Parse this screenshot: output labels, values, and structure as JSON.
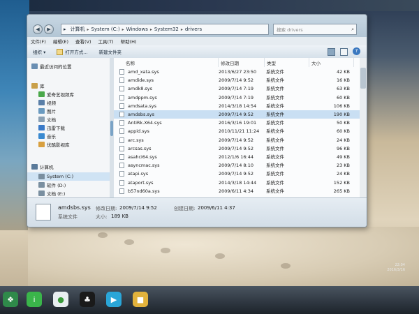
{
  "window": {
    "address": [
      "计算机",
      "System (C:)",
      "Windows",
      "System32",
      "drivers"
    ],
    "search_placeholder": "搜索 drivers"
  },
  "menubar": [
    "文件(F)",
    "编辑(E)",
    "查看(V)",
    "工具(T)",
    "帮助(H)"
  ],
  "toolbar": {
    "organize": "组织 ▾",
    "open_with": "打开方式...",
    "new_folder": "新建文件夹"
  },
  "nav": {
    "items": [
      {
        "label": "最近访问的位置",
        "icon": "recent-places-icon",
        "color": "#6a8fb3"
      },
      {
        "label": "库",
        "icon": "library-icon",
        "color": "#c9a04a"
      },
      {
        "label": "爱奇艺视频库",
        "icon": "video-library-icon",
        "color": "#4aa84a"
      },
      {
        "label": "视频",
        "icon": "video-icon",
        "color": "#5a7fa8"
      },
      {
        "label": "图片",
        "icon": "pictures-icon",
        "color": "#6a9ac0"
      },
      {
        "label": "文档",
        "icon": "documents-icon",
        "color": "#8aa0b4"
      },
      {
        "label": "迅雷下载",
        "icon": "thunder-download-icon",
        "color": "#3a7ac8"
      },
      {
        "label": "音乐",
        "icon": "music-icon",
        "color": "#3a8ad0"
      },
      {
        "label": "优酷影视库",
        "icon": "youku-library-icon",
        "color": "#d8a040"
      },
      {
        "label": "计算机",
        "icon": "computer-icon",
        "color": "#5a7a9a"
      },
      {
        "label": "System (C:)",
        "icon": "drive-icon",
        "color": "#7a8fa0"
      },
      {
        "label": "软件 (D:)",
        "icon": "drive-icon",
        "color": "#7a8fa0"
      },
      {
        "label": "文档 (E:)",
        "icon": "drive-icon",
        "color": "#7a8fa0"
      }
    ],
    "selected_index": 10
  },
  "columns": {
    "name": "名称",
    "date": "修改日期",
    "type": "类型",
    "size": "大小"
  },
  "files": [
    {
      "name": "amd_xata.sys",
      "date": "2013/6/27 23:50",
      "type": "系统文件",
      "size": "42 KB"
    },
    {
      "name": "amdide.sys",
      "date": "2009/7/14 9:52",
      "type": "系统文件",
      "size": "16 KB"
    },
    {
      "name": "amdk8.sys",
      "date": "2009/7/14 7:19",
      "type": "系统文件",
      "size": "63 KB"
    },
    {
      "name": "amdppm.sys",
      "date": "2009/7/14 7:19",
      "type": "系统文件",
      "size": "60 KB"
    },
    {
      "name": "amdsata.sys",
      "date": "2014/3/18 14:54",
      "type": "系统文件",
      "size": "106 KB"
    },
    {
      "name": "amdsbs.sys",
      "date": "2009/7/14 9:52",
      "type": "系统文件",
      "size": "190 KB"
    },
    {
      "name": "AntiRk.X64.sys",
      "date": "2016/3/16 19:01",
      "type": "系统文件",
      "size": "50 KB"
    },
    {
      "name": "appid.sys",
      "date": "2010/11/21 11:24",
      "type": "系统文件",
      "size": "60 KB"
    },
    {
      "name": "arc.sys",
      "date": "2009/7/14 9:52",
      "type": "系统文件",
      "size": "24 KB"
    },
    {
      "name": "arcsas.sys",
      "date": "2009/7/14 9:52",
      "type": "系统文件",
      "size": "96 KB"
    },
    {
      "name": "asahci64.sys",
      "date": "2012/1/6 16:44",
      "type": "系统文件",
      "size": "49 KB"
    },
    {
      "name": "asyncmac.sys",
      "date": "2009/7/14 8:10",
      "type": "系统文件",
      "size": "23 KB"
    },
    {
      "name": "atapi.sys",
      "date": "2009/7/14 9:52",
      "type": "系统文件",
      "size": "24 KB"
    },
    {
      "name": "ataport.sys",
      "date": "2014/3/18 14:44",
      "type": "系统文件",
      "size": "152 KB"
    },
    {
      "name": "b57nd60a.sys",
      "date": "2009/6/11 4:34",
      "type": "系统文件",
      "size": "265 KB"
    }
  ],
  "selected_file_index": 5,
  "details": {
    "name": "amdsbs.sys",
    "modified_label": "修改日期:",
    "modified": "2009/7/14 9:52",
    "created_label": "创建日期:",
    "created": "2009/6/11 4:37",
    "type": "系统文件",
    "size_label": "大小:",
    "size": "189 KB"
  },
  "tray": {
    "time": "22:04",
    "date": "2016/3/16"
  },
  "taskbar": [
    {
      "icon": "start-icon",
      "glyph": "❖",
      "color": "#2f8a4a"
    },
    {
      "icon": "iqiyi-icon",
      "glyph": "i",
      "color": "#3ab54a"
    },
    {
      "icon": "wechat-icon",
      "glyph": "●",
      "color": "#e8eef0"
    },
    {
      "icon": "qq-icon",
      "glyph": "♣",
      "color": "#1a1a1a"
    },
    {
      "icon": "media-player-icon",
      "glyph": "▶",
      "color": "#2aa6d8"
    },
    {
      "icon": "folder-icon",
      "glyph": "■",
      "color": "#e2b23c"
    }
  ]
}
